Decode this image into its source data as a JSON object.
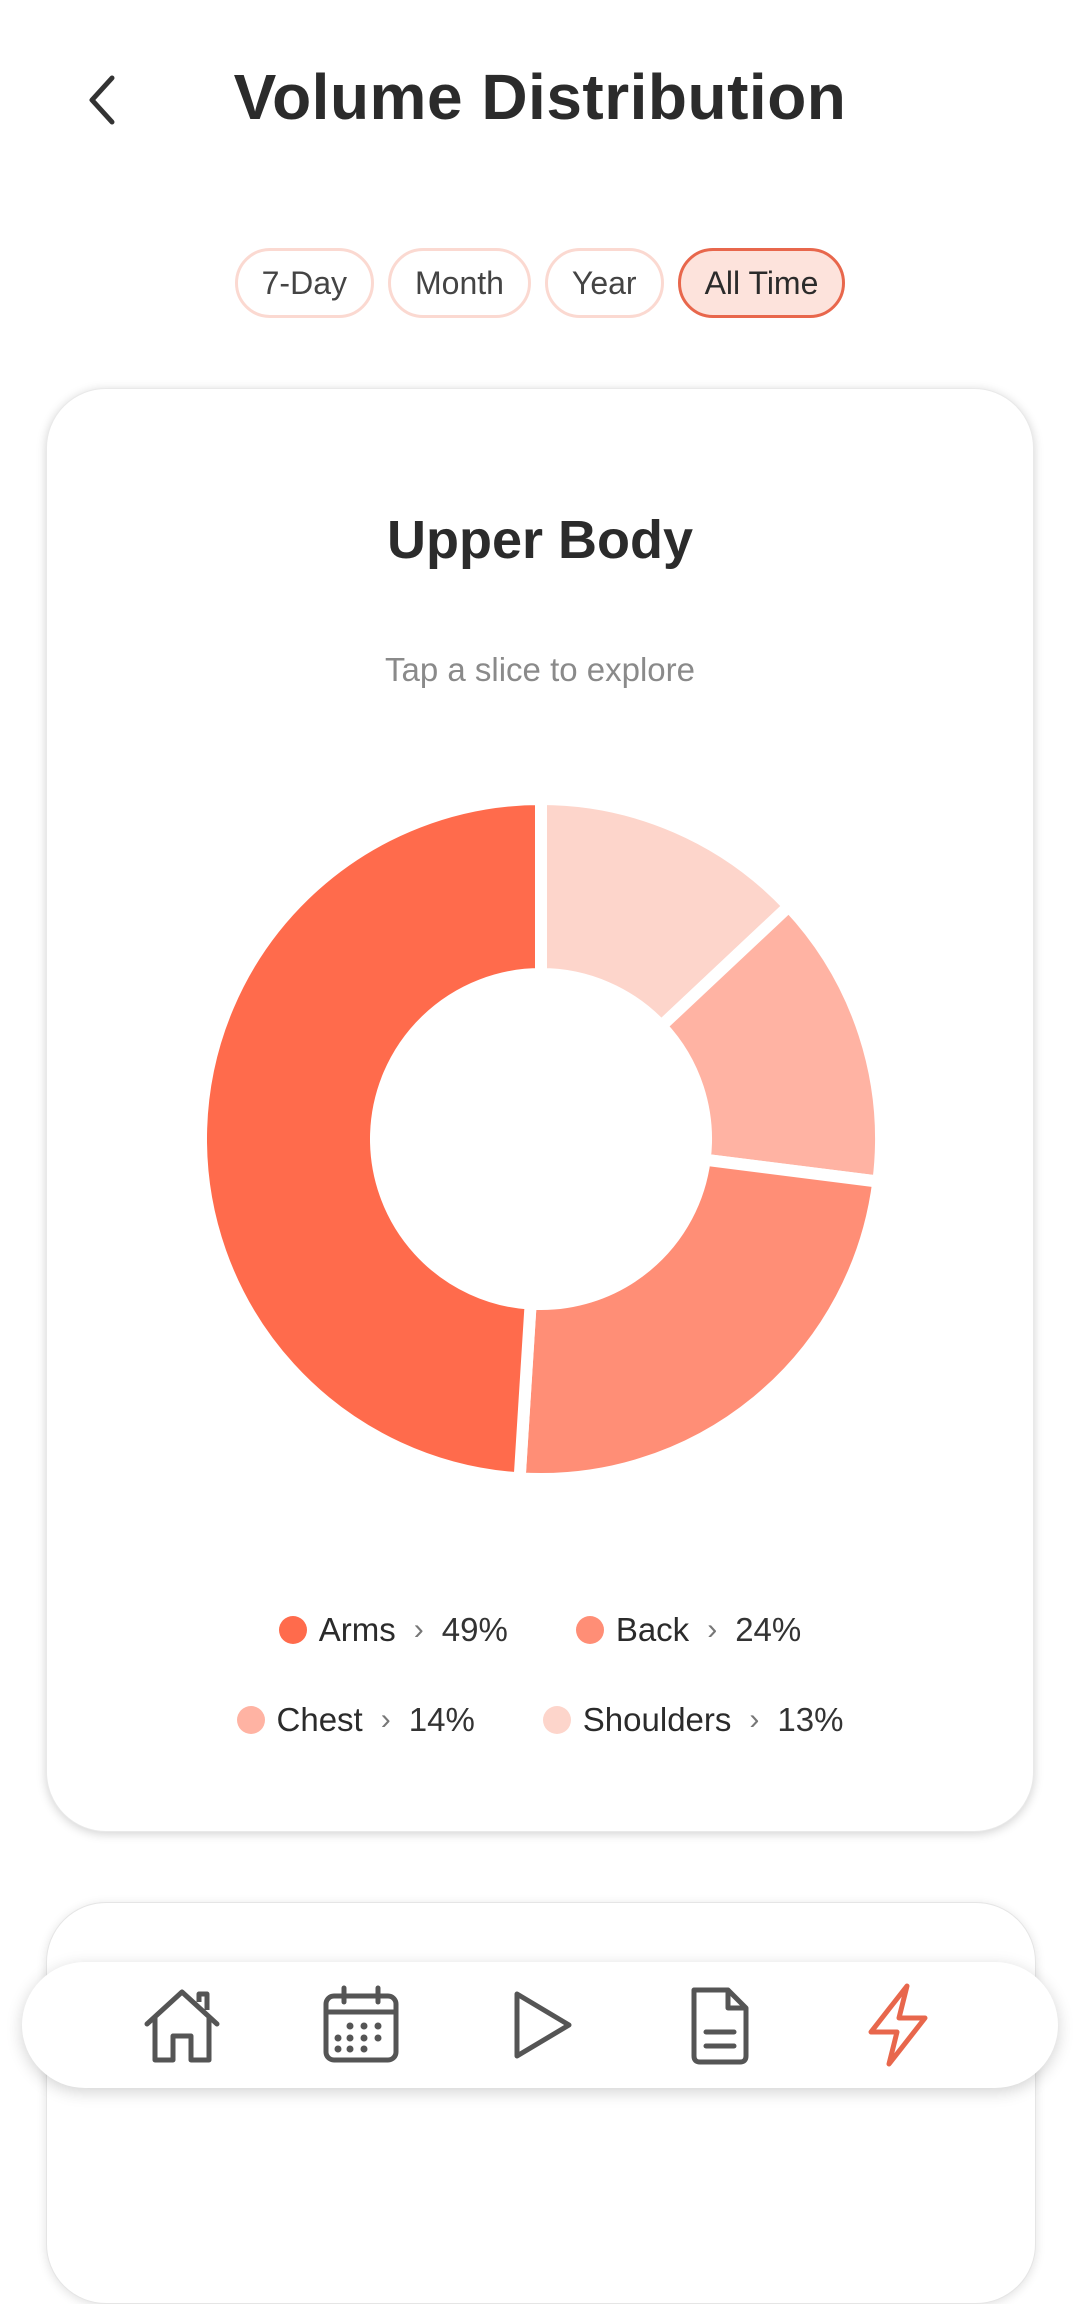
{
  "header": {
    "title": "Volume Distribution"
  },
  "filters": [
    {
      "label": "7-Day",
      "active": false
    },
    {
      "label": "Month",
      "active": false
    },
    {
      "label": "Year",
      "active": false
    },
    {
      "label": "All Time",
      "active": true
    }
  ],
  "card": {
    "title": "Upper Body",
    "subtitle": "Tap a slice to explore"
  },
  "chart_data": {
    "type": "pie",
    "title": "Upper Body",
    "categories": [
      "Arms",
      "Back",
      "Chest",
      "Shoulders"
    ],
    "values": [
      49,
      24,
      14,
      13
    ],
    "colors": [
      "#ff6b4c",
      "#ff8e76",
      "#ffb3a3",
      "#fdd5cb"
    ],
    "unit": "%",
    "donut": true,
    "legend": "bottom"
  },
  "legend": [
    {
      "name": "Arms",
      "pct": "49%",
      "color": "#ff6b4c"
    },
    {
      "name": "Back",
      "pct": "24%",
      "color": "#ff8e76"
    },
    {
      "name": "Chest",
      "pct": "14%",
      "color": "#ffb3a3"
    },
    {
      "name": "Shoulders",
      "pct": "13%",
      "color": "#fdd5cb"
    }
  ],
  "colors": {
    "accent": "#e8674c",
    "chip_active_bg": "#fde3dc",
    "chip_border": "#fbd9d1"
  },
  "nav": [
    {
      "icon": "home-icon",
      "active": false
    },
    {
      "icon": "calendar-icon",
      "active": false
    },
    {
      "icon": "play-icon",
      "active": false
    },
    {
      "icon": "document-icon",
      "active": false
    },
    {
      "icon": "lightning-icon",
      "active": true
    }
  ]
}
